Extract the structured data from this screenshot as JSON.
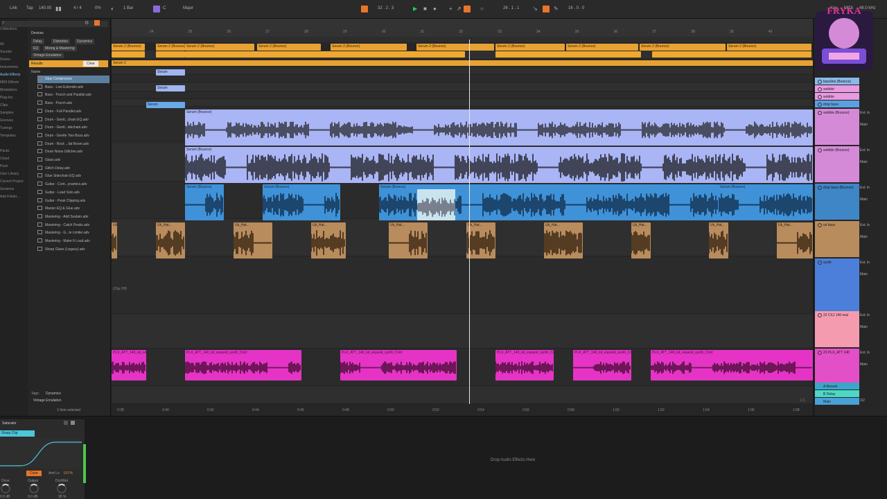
{
  "transport": {
    "link": "Link",
    "tap": "Tap",
    "tempo": "140.00",
    "signature": "4 / 4",
    "cpu": "0%",
    "quantize": "1 Bar",
    "key": "C",
    "scale": "Major",
    "position": "32 . 2 . 3",
    "loop_start": "26 . 1 . 1",
    "loop_len": "16 . 0 . 0",
    "key_label": "Key",
    "midi_label": "MIDI",
    "rate": "48.0 kHz",
    "colors": {
      "accent": "#e8752a",
      "play": "#22cc55"
    }
  },
  "browser": {
    "search_placeholder": "",
    "header": "Devices",
    "tags_row1": [
      "Delay",
      "Distortion",
      "Dynamics"
    ],
    "tags_row2": [
      "EQ",
      "Mixing & Mastering"
    ],
    "tags_row3": [
      "Vintage Emulation"
    ],
    "results_label": "Results",
    "clear_label": "Clear",
    "name_col": "Name",
    "places": [
      "Collections",
      "",
      "All",
      "Sounds",
      "Drums",
      "Instruments",
      "Audio Effects",
      "MIDI Effects",
      "Modulators",
      "Plug-Ins",
      "Clips",
      "Samples",
      "Grooves",
      "Tunings",
      "Templates",
      "",
      "Packs",
      "Cloud",
      "Push",
      "User Library",
      "Current Project",
      "Sessions",
      "Add Folder..."
    ],
    "files": [
      "Glue Compressor",
      "Bass - Low Extender.adv",
      "Bass - Punch and Parallel.adv",
      "Bass - Punch.adv",
      "Drum - Full Parallel.adv",
      "Drum - Gentl...chain EQ.adv",
      "Drum - Gentl...idechain.adv",
      "Drum - Gentle Two Buss.adv",
      "Drum - Rock ...fat Room.adv",
      "Drum Noise Glitcher.adv",
      "Glass.adv",
      "Glitch Delay.adv",
      "Glue Sidechain EQ.adv",
      "Guitar - Cont...ynamics.adv",
      "Guitar - Lead Solo.adv",
      "Guitar - Peak Clipping.adv",
      "Master EQ & Glue.adv",
      "Mastering - Add Sustain.adv",
      "Mastering - Catch Peaks.adv",
      "Mastering - G...le Limiter.adv",
      "Mastering - Make It Loud.adv",
      "Sharp Glass (Legacy).adv"
    ],
    "footer_tags_label": "Tags:",
    "footer_tag1": "Dynamics",
    "footer_tag2": "Vintage Emulation",
    "status": "1 Item selected"
  },
  "ruler": [
    "24",
    "25",
    "26",
    "27",
    "28",
    "29",
    "30",
    "31",
    "32",
    "33",
    "34",
    "35",
    "36",
    "37",
    "38",
    "39",
    "40"
  ],
  "time_ruler": [
    "0:38",
    "0:40",
    "0:42",
    "0:44",
    "0:46",
    "0:48",
    "0:50",
    "0:52",
    "0:54",
    "0:56",
    "0:58",
    "1:00",
    "1:02",
    "1:04",
    "1:06",
    "1:08"
  ],
  "clips": {
    "serum2_bounce": "Serum 2 (Bounce)",
    "serum_bounce": "Serum (Bounce)",
    "serum2": "Serum 2",
    "serum": "Serum",
    "drop_bass": "Serum (Bounce)",
    "uk_hat": "Uk_Hat...",
    "fx": "PLX_ATT_140_kit_expand_synth_Crint",
    "off": "(Clip Off)"
  },
  "tracks": [
    {
      "name": "bassline (Bounce)",
      "color": "#8ab8e8",
      "input": "",
      "output": ""
    },
    {
      "name": "wobble",
      "color": "#e79be0",
      "input": "",
      "output": ""
    },
    {
      "name": "wobble",
      "color": "#e79be0",
      "input": "",
      "output": ""
    },
    {
      "name": "drop bass",
      "color": "#5aa0e0",
      "input": "",
      "output": ""
    },
    {
      "name": "wobble (Bounce)",
      "color": "#d58ad8",
      "input": "Ext. In",
      "output": "Main"
    },
    {
      "name": "wobble (Bounce)",
      "color": "#d58ad8",
      "input": "Ext. In",
      "output": "Main"
    },
    {
      "name": "drop bass (Bounce)",
      "color": "#3e86c6",
      "input": "Ext. In",
      "output": "Main"
    },
    {
      "name": "uk bass",
      "color": "#b98c5e",
      "input": "Ext. In",
      "output": "Main"
    },
    {
      "name": "synth",
      "color": "#4c7fd9",
      "input": "Ext. In",
      "output": "Main"
    },
    {
      "name": "22 CXJ 140 real",
      "color": "#f59bb0",
      "input": "Ext. In",
      "output": "Main"
    },
    {
      "name": "23 PLX_ATT 140",
      "color": "#e34fc6",
      "input": "Ext. In",
      "output": "Main"
    }
  ],
  "returns": [
    {
      "name": "A Reverb",
      "color": "#3aa7c9"
    },
    {
      "name": "B Delay",
      "color": "#4dd8c6"
    },
    {
      "name": "Main",
      "color": "#4aa1d8"
    }
  ],
  "ratio_label": "1/1",
  "main_out_label": "1/2",
  "detail": {
    "device_name": "Saturator",
    "mode": "Sharp Clip",
    "color_label": "Color",
    "amt_label": "Amt Lo",
    "amt_value": "0.0 %",
    "drive_label": "Drive",
    "drive_value": "0.0 dB",
    "output_label": "Output",
    "output_value": "0.0 dB",
    "drywet_label": "Dry/Wet",
    "drywet_value": "38 %",
    "drop_hint": "Drop Audio Effects Here"
  }
}
